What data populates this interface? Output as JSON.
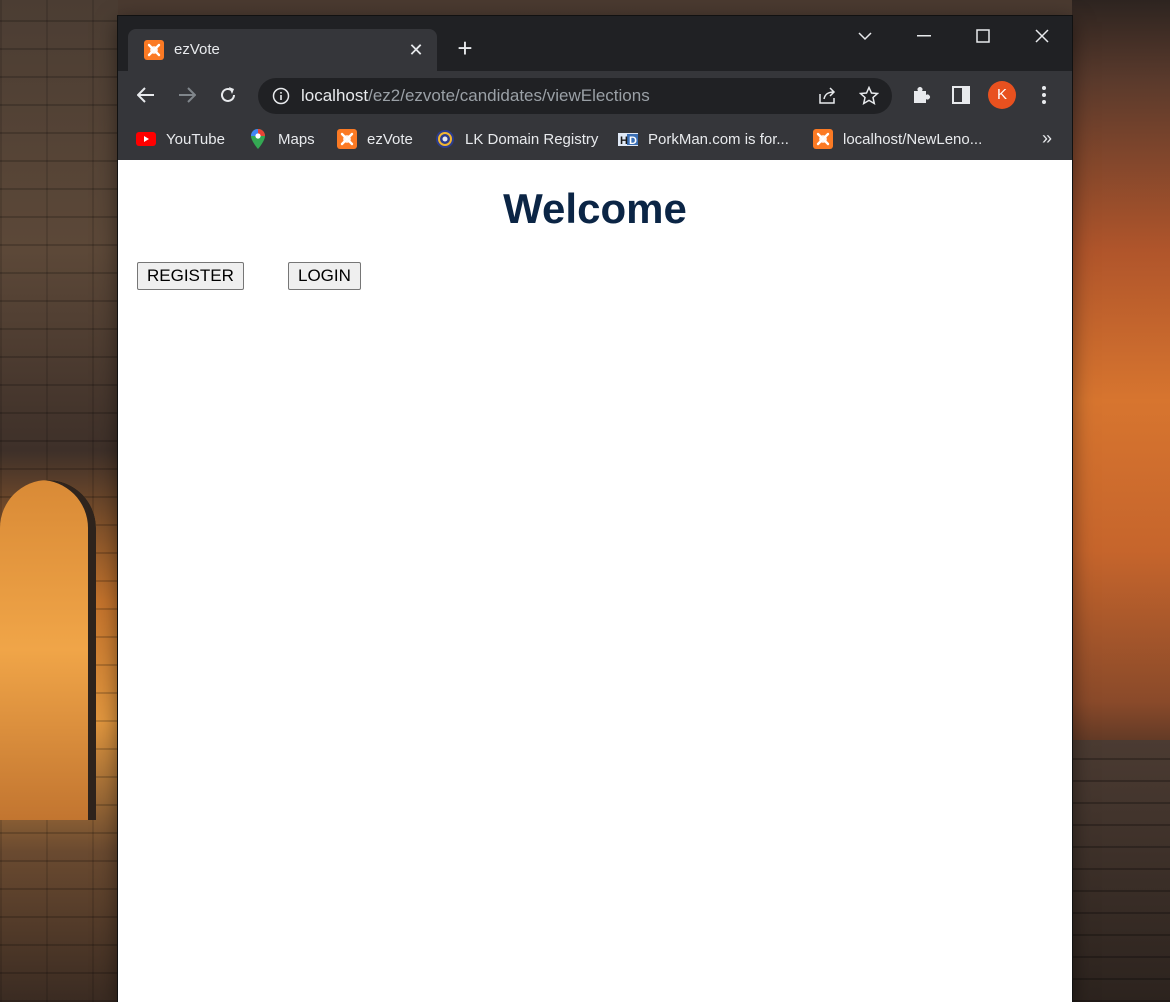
{
  "browser": {
    "tab": {
      "title": "ezVote"
    },
    "address": {
      "host": "localhost",
      "path": "/ez2/ezvote/candidates/viewElections"
    },
    "profile": {
      "initial": "K"
    },
    "bookmarks": [
      {
        "label": "YouTube",
        "icon": "youtube-icon"
      },
      {
        "label": "Maps",
        "icon": "maps-icon"
      },
      {
        "label": "ezVote",
        "icon": "xampp-icon"
      },
      {
        "label": "LK Domain Registry",
        "icon": "lk-domain-icon"
      },
      {
        "label": "PorkMan.com is for...",
        "icon": "porkman-icon"
      },
      {
        "label": "localhost/NewLeno...",
        "icon": "xampp-icon"
      }
    ],
    "bookmarks_more": "»"
  },
  "page": {
    "heading": "Welcome",
    "register_label": "REGISTER",
    "login_label": "LOGIN"
  },
  "colors": {
    "heading": "#0b2545",
    "tab_active": "#35363a",
    "titlebar": "#202124",
    "avatar": "#e8511f",
    "xampp_orange": "#fb7a24"
  }
}
